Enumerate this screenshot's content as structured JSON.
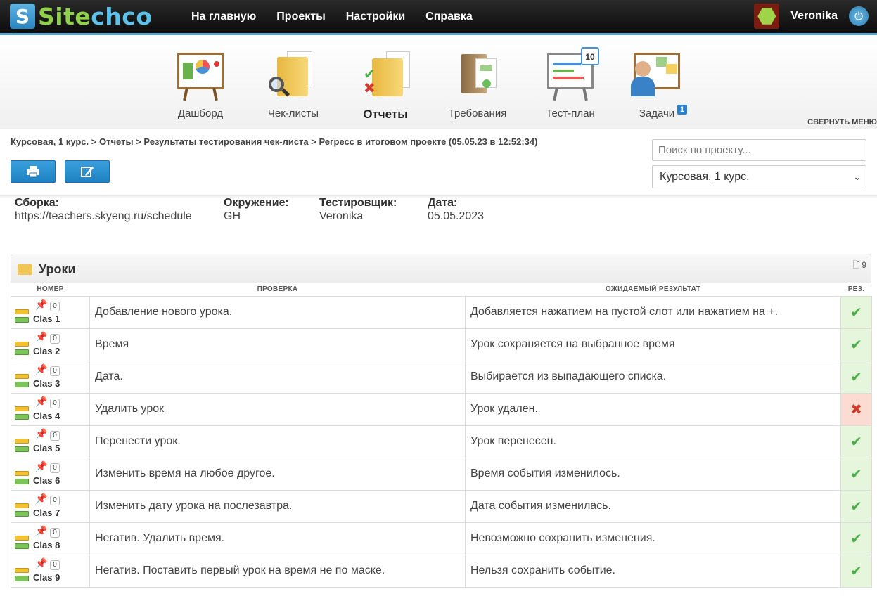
{
  "header": {
    "logo_text_a": "Site",
    "logo_text_b": "chco",
    "nav": [
      "На главную",
      "Проекты",
      "Настройки",
      "Справка"
    ],
    "username": "Veronika"
  },
  "modules": [
    {
      "label": "Дашборд",
      "icon": "dashboard-icon"
    },
    {
      "label": "Чек-листы",
      "icon": "checklists-icon"
    },
    {
      "label": "Отчеты",
      "icon": "reports-icon",
      "active": true
    },
    {
      "label": "Требования",
      "icon": "requirements-icon"
    },
    {
      "label": "Тест-план",
      "icon": "testplan-icon",
      "calendar_day": "10"
    },
    {
      "label": "Задачи",
      "icon": "tasks-icon",
      "badge": "1"
    }
  ],
  "collapse_menu": "СВЕРНУТЬ МЕНЮ",
  "breadcrumb": {
    "project": "Курсовая, 1 курс.",
    "reports": "Отчеты",
    "rest": "Результаты тестирования чек-листа > Регресс в итоговом проекте (05.05.23 в 12:52:34)"
  },
  "search": {
    "placeholder": "Поиск по проекту..."
  },
  "project_select": {
    "value": "Курсовая, 1 курс."
  },
  "meta": {
    "build_label": "Сборка:",
    "build_value": "https://teachers.skyeng.ru/schedule",
    "env_label": "Окружение:",
    "env_value": "GH",
    "tester_label": "Тестировщик:",
    "tester_value": "Veronika",
    "date_label": "Дата:",
    "date_value": "05.05.2023"
  },
  "section": {
    "title": "Уроки",
    "count": "9",
    "columns": [
      "НОМЕР",
      "ПРОВЕРКА",
      "ОЖИДАЕМЫЙ РЕЗУЛЬТАТ",
      "РЕЗ."
    ],
    "rows": [
      {
        "id": "Clas 1",
        "comments": "0",
        "check": "Добавление нового урока.",
        "expected": "Добавляется нажатием на пустой слот или нажатием на +.",
        "result": "pass"
      },
      {
        "id": "Clas 2",
        "comments": "0",
        "check": "Время",
        "expected": "Урок сохраняется на выбранное время",
        "result": "pass"
      },
      {
        "id": "Clas 3",
        "comments": "0",
        "check": "Дата.",
        "expected": "Выбирается из выпадающего списка.",
        "result": "pass"
      },
      {
        "id": "Clas 4",
        "comments": "0",
        "check": "Удалить урок",
        "expected": "Урок удален.",
        "result": "fail"
      },
      {
        "id": "Clas 5",
        "comments": "0",
        "check": "Перенести урок.",
        "expected": "Урок перенесен.",
        "result": "pass"
      },
      {
        "id": "Clas 6",
        "comments": "0",
        "check": "Изменить время на любое другое.",
        "expected": "Время события изменилось.",
        "result": "pass"
      },
      {
        "id": "Clas 7",
        "comments": "0",
        "check": "Изменить дату урока на послезавтра.",
        "expected": "Дата события изменилась.",
        "result": "pass"
      },
      {
        "id": "Clas 8",
        "comments": "0",
        "check": "Негатив. Удалить время.",
        "expected": "Невозможно сохранить изменения.",
        "result": "pass"
      },
      {
        "id": "Clas 9",
        "comments": "0",
        "check": "Негатив. Поставить первый урок на время не по маске.",
        "expected": "Нельзя сохранить событие.",
        "result": "pass"
      }
    ]
  },
  "colors": {
    "accent": "#2a84c0",
    "pass": "#4cb04a",
    "fail": "#d03a2c"
  }
}
